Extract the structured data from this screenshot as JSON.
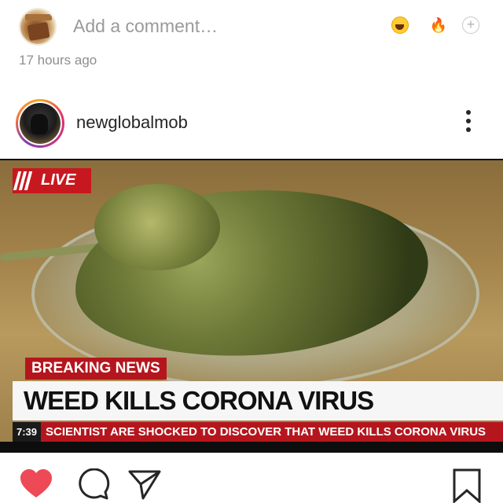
{
  "comment_bar": {
    "placeholder": "Add a comment…",
    "quick_reactions": [
      "laughing-emoji",
      "fire-emoji"
    ],
    "fire_glyph": "🔥",
    "add_glyph": "+",
    "timestamp": "17 hours ago"
  },
  "post": {
    "username": "newglobalmob",
    "image": {
      "live_label": "LIVE",
      "breaking_label": "BREAKING NEWS",
      "headline": "WEED KILLS CORONA VIRUS",
      "ticker_time": "7:39",
      "ticker_text": "SCIENTIST ARE SHOCKED TO DISCOVER THAT WEED KILLS CORONA VIRUS"
    }
  },
  "actions": {
    "like_icon": "heart-icon",
    "like_color": "#ed4956",
    "comment_icon": "comment-icon",
    "share_icon": "share-icon",
    "save_icon": "bookmark-icon"
  }
}
